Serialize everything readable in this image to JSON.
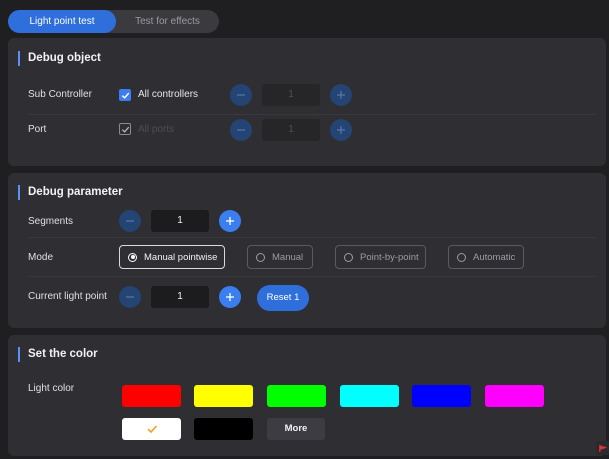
{
  "tabs": [
    {
      "label": "Light point test",
      "active": true
    },
    {
      "label": "Test for effects",
      "active": false
    }
  ],
  "debug_object": {
    "title": "Debug object",
    "sub_controller": {
      "label": "Sub Controller",
      "checkbox_label": "All controllers",
      "checked": true,
      "value": "1"
    },
    "port": {
      "label": "Port",
      "checkbox_label": "All ports",
      "checked": true,
      "disabled": true,
      "value": "1"
    }
  },
  "debug_parameter": {
    "title": "Debug parameter",
    "segments": {
      "label": "Segments",
      "value": "1"
    },
    "mode": {
      "label": "Mode",
      "options": [
        "Manual pointwise",
        "Manual",
        "Point-by-point",
        "Automatic"
      ],
      "selected": "Manual pointwise"
    },
    "current_light_point": {
      "label": "Current light point",
      "value": "1"
    },
    "reset_label": "Reset 1"
  },
  "set_color": {
    "title": "Set the color",
    "light_color_label": "Light color",
    "swatches": [
      "#ff0000",
      "#ffff00",
      "#00ff00",
      "#00ffff",
      "#0000ff",
      "#ff00ff",
      "#ffffff",
      "#000000"
    ],
    "selected_swatch": "#ffffff",
    "check_color": "#f0a020",
    "more_label": "More"
  },
  "colors": {
    "accent": "#2f6fdb",
    "accent_bright": "#3b7ef0",
    "background": "#1f1f22",
    "panel": "#2e2e33"
  },
  "icons": {
    "minus": "minus-icon",
    "plus": "plus-icon",
    "check": "check-icon",
    "corner": "flag-icon"
  }
}
